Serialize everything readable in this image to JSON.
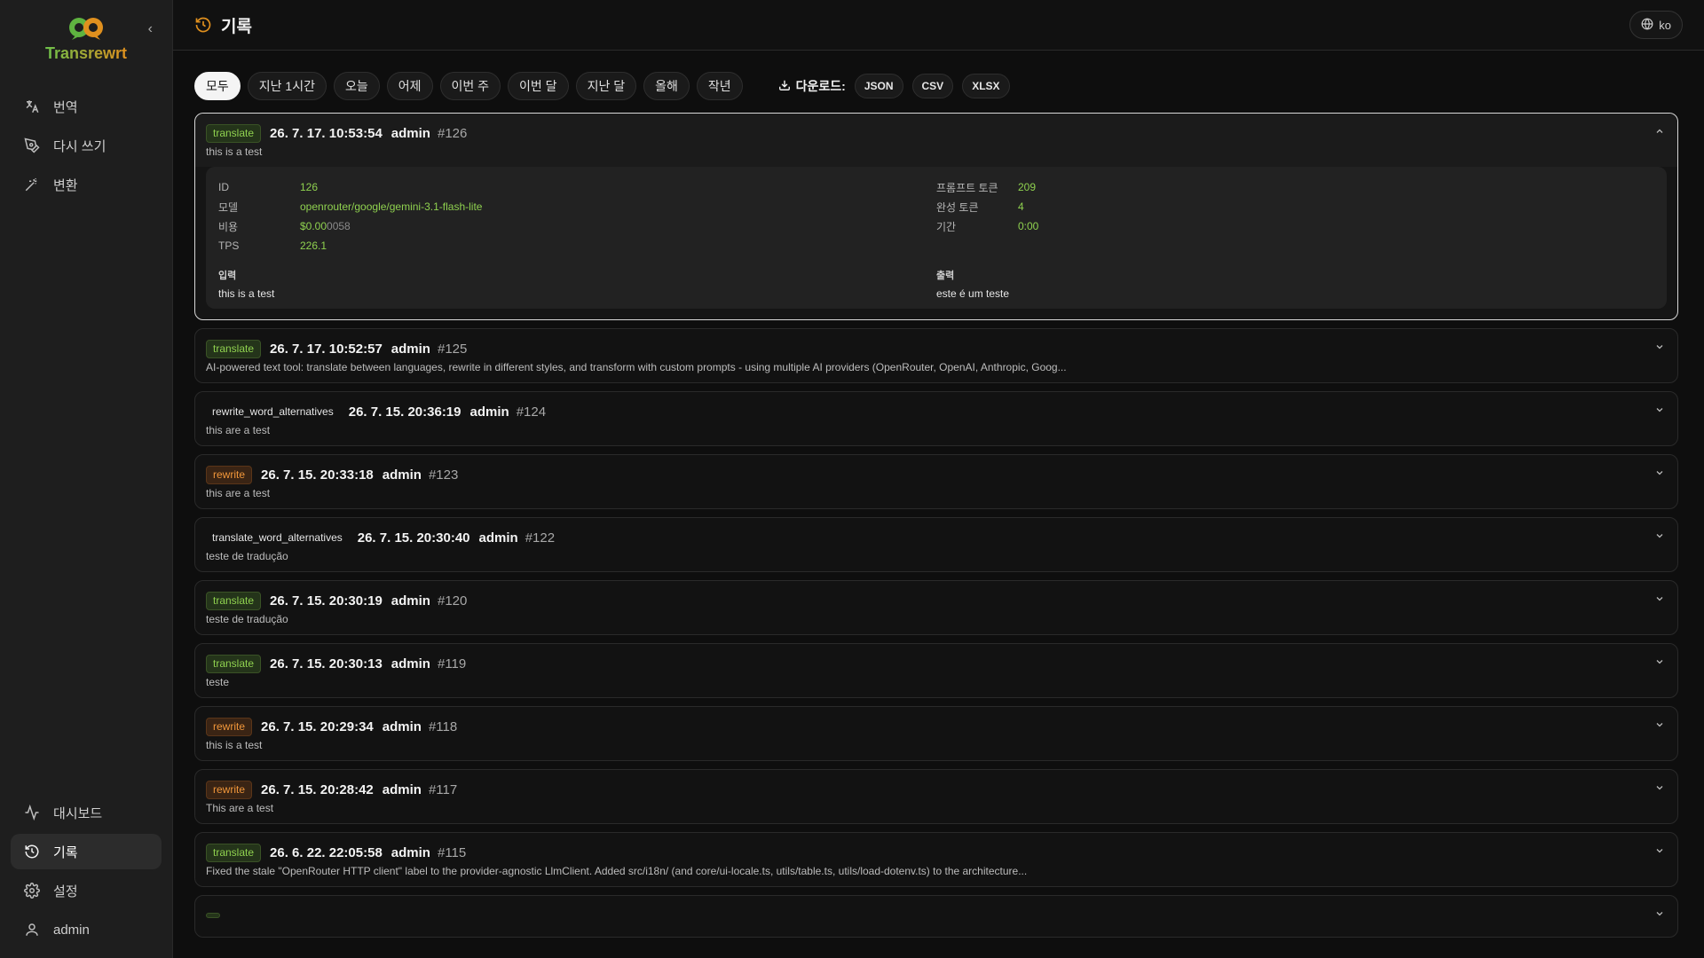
{
  "brand": {
    "name": "Transrewrt",
    "collapse_glyph": "‹"
  },
  "sidebar": {
    "top_items": [
      {
        "label": "번역",
        "icon": "translate-icon"
      },
      {
        "label": "다시 쓰기",
        "icon": "pen-icon"
      },
      {
        "label": "변환",
        "icon": "wand-icon"
      }
    ],
    "bottom_items": [
      {
        "label": "대시보드",
        "icon": "activity-icon"
      },
      {
        "label": "기록",
        "icon": "history-icon",
        "active": true
      },
      {
        "label": "설정",
        "icon": "gear-icon"
      },
      {
        "label": "admin",
        "icon": "user-icon"
      }
    ]
  },
  "header": {
    "title": "기록",
    "lang": "ko"
  },
  "filters": [
    "모두",
    "지난 1시간",
    "오늘",
    "어제",
    "이번 주",
    "이번 달",
    "지난 달",
    "올해",
    "작년"
  ],
  "download": {
    "label": "다운로드:",
    "formats": [
      "JSON",
      "CSV",
      "XLSX"
    ]
  },
  "expanded": {
    "type": "translate",
    "timestamp": "26. 7. 17. 10:53:54",
    "user": "admin",
    "id_tag": "#126",
    "preview": "this is a test",
    "details": {
      "id_label": "ID",
      "id_value": "126",
      "model_label": "모델",
      "model_value": "openrouter/google/gemini-3.1-flash-lite",
      "cost_label": "비용",
      "cost_value_main": "$0.00",
      "cost_value_dim": "0058",
      "tps_label": "TPS",
      "tps_value": "226.1",
      "prompt_tokens_label": "프롬프트 토큰",
      "prompt_tokens_value": "209",
      "completion_tokens_label": "완성 토큰",
      "completion_tokens_value": "4",
      "duration_label": "기간",
      "duration_value": "0:00",
      "input_label": "입력",
      "input_text": "this is a test",
      "output_label": "출력",
      "output_text": "este é um teste"
    }
  },
  "entries": [
    {
      "type": "translate",
      "badge": "translate",
      "timestamp": "26. 7. 17. 10:52:57",
      "user": "admin",
      "id_tag": "#125",
      "preview": "AI-powered text tool: translate between languages, rewrite in different styles, and transform with custom prompts - using multiple AI providers (OpenRouter, OpenAI, Anthropic, Goog..."
    },
    {
      "type": "plain",
      "badge": "rewrite_word_alternatives",
      "timestamp": "26. 7. 15. 20:36:19",
      "user": "admin",
      "id_tag": "#124",
      "preview": "this are a test"
    },
    {
      "type": "rewrite",
      "badge": "rewrite",
      "timestamp": "26. 7. 15. 20:33:18",
      "user": "admin",
      "id_tag": "#123",
      "preview": "this are a test"
    },
    {
      "type": "plain",
      "badge": "translate_word_alternatives",
      "timestamp": "26. 7. 15. 20:30:40",
      "user": "admin",
      "id_tag": "#122",
      "preview": "teste de tradução"
    },
    {
      "type": "translate",
      "badge": "translate",
      "timestamp": "26. 7. 15. 20:30:19",
      "user": "admin",
      "id_tag": "#120",
      "preview": "teste de tradução"
    },
    {
      "type": "translate",
      "badge": "translate",
      "timestamp": "26. 7. 15. 20:30:13",
      "user": "admin",
      "id_tag": "#119",
      "preview": "teste"
    },
    {
      "type": "rewrite",
      "badge": "rewrite",
      "timestamp": "26. 7. 15. 20:29:34",
      "user": "admin",
      "id_tag": "#118",
      "preview": "this is a test"
    },
    {
      "type": "rewrite",
      "badge": "rewrite",
      "timestamp": "26. 7. 15. 20:28:42",
      "user": "admin",
      "id_tag": "#117",
      "preview": "This are a test"
    },
    {
      "type": "translate",
      "badge": "translate",
      "timestamp": "26. 6. 22. 22:05:58",
      "user": "admin",
      "id_tag": "#115",
      "preview": "Fixed the stale \"OpenRouter HTTP client\" label to the provider-agnostic LlmClient. Added src/i18n/ (and core/ui-locale.ts, utils/table.ts, utils/load-dotenv.ts) to the architecture..."
    },
    {
      "type": "translate",
      "badge": "",
      "timestamp": "",
      "user": "",
      "id_tag": "",
      "preview": ""
    }
  ],
  "colors": {
    "translate": "#8fd14f",
    "rewrite": "#f0963a",
    "accent": "#e0901e"
  }
}
